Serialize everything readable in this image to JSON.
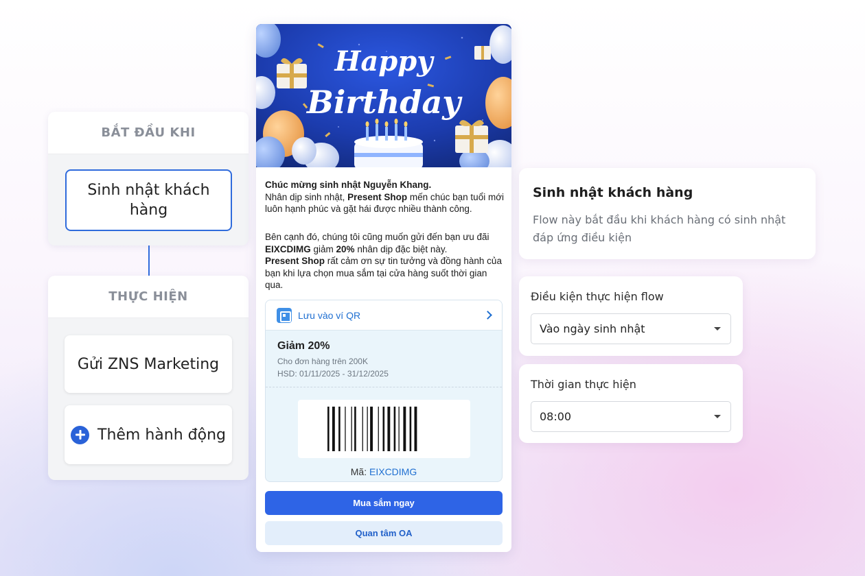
{
  "flow": {
    "start": {
      "header": "BẮT ĐẦU KHI",
      "trigger": "Sinh nhật khách hàng"
    },
    "actions": {
      "header": "THỰC HIỆN",
      "items": [
        "Gửi ZNS Marketing"
      ],
      "add_label": "Thêm hành động"
    }
  },
  "message": {
    "banner_title_1": "Happy",
    "banner_title_2": "Birthday",
    "greeting": "Chúc mừng sinh nhật Nguyễn Khang.",
    "p1_before": "Nhân dịp sinh nhật, ",
    "shop_name": "Present Shop",
    "p1_after": " mến chúc bạn tuổi mới luôn hạnh phúc và gặt hái được nhiều thành công.",
    "p2_part1": "Bên cạnh đó, chúng tôi cũng muốn gửi đến bạn ưu đãi ",
    "p2_code": "EIXCDIMG",
    "p2_part2": " giảm ",
    "p2_percent": "20%",
    "p2_part3": " nhân dịp đặc biệt này.",
    "p3_shop": "Present Shop",
    "p3_rest": " rất cảm ơn sự tin tưởng và đồng hành của bạn khi lựa chọn mua sắm tại cửa hàng suốt thời gian qua.",
    "voucher": {
      "save_label": "Lưu vào ví QR",
      "title": "Giảm 20%",
      "condition": "Cho đơn hàng trên 200K",
      "expiry": "HSD: 01/11/2025 - 31/12/2025",
      "code_label": "Mã:",
      "code": "EIXCDIMG"
    },
    "buttons": {
      "primary": "Mua sắm ngay",
      "secondary": "Quan tâm OA"
    }
  },
  "settings": {
    "info": {
      "title": "Sinh nhật khách hàng",
      "description": "Flow này bắt đầu khi khách hàng có sinh nhật đáp ứng điều kiện"
    },
    "condition": {
      "label": "Điều kiện thực hiện flow",
      "value": "Vào ngày sinh nhật"
    },
    "time": {
      "label": "Thời gian thực hiện",
      "value": "08:00"
    }
  },
  "colors": {
    "accent": "#2f6bdc",
    "banner_blue": "#1e3fb8",
    "link": "#1f6fd1"
  }
}
